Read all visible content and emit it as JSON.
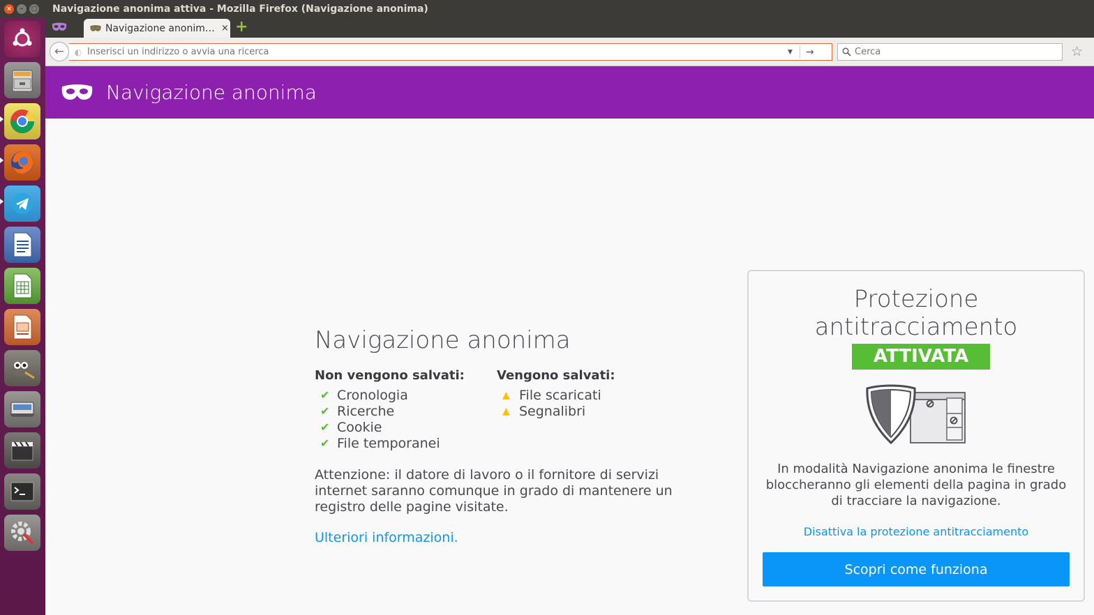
{
  "window": {
    "title": "Navigazione anonima attiva - Mozilla Firefox (Navigazione anonima)",
    "buttons": {
      "close": "×",
      "minimize": "–",
      "maximize": "□"
    }
  },
  "launcher": {
    "items": [
      {
        "name": "ubuntu-dash",
        "icon": "ubuntu-logo-icon"
      },
      {
        "name": "files",
        "icon": "file-cabinet-icon"
      },
      {
        "name": "chrome",
        "icon": "chrome-icon"
      },
      {
        "name": "firefox",
        "icon": "firefox-icon"
      },
      {
        "name": "telegram",
        "icon": "telegram-icon"
      },
      {
        "name": "writer",
        "icon": "libreoffice-writer-icon"
      },
      {
        "name": "calc",
        "icon": "libreoffice-calc-icon"
      },
      {
        "name": "impress",
        "icon": "libreoffice-impress-icon"
      },
      {
        "name": "gimp",
        "icon": "gimp-icon"
      },
      {
        "name": "scanner",
        "icon": "scanner-icon"
      },
      {
        "name": "video-editor",
        "icon": "clapperboard-icon"
      },
      {
        "name": "terminal",
        "icon": "terminal-icon"
      },
      {
        "name": "system-settings",
        "icon": "settings-icon"
      }
    ]
  },
  "tabs": {
    "active_label": "Navigazione anonim…",
    "close": "×",
    "new_tab": "+"
  },
  "navbar": {
    "back": "←",
    "url_placeholder": "Inserisci un indirizzo o avvia una ricerca",
    "url_drop": "▼",
    "url_go": "→",
    "search_placeholder": "Cerca",
    "star": "☆"
  },
  "header": {
    "title": "Navigazione anonima"
  },
  "main": {
    "title": "Navigazione anonima",
    "not_saved": {
      "title": "Non vengono salvati:",
      "items": [
        "Cronologia",
        "Ricerche",
        "Cookie",
        "File temporanei"
      ],
      "mark": "✔"
    },
    "saved": {
      "title": "Vengono salvati:",
      "items": [
        "File scaricati",
        "Segnalibri"
      ],
      "mark": "▲"
    },
    "warning": "Attenzione: il datore di lavoro o il fornitore di servizi internet saranno comunque in grado di mantenere un registro delle pagine visitate.",
    "more_link": "Ulteriori informazioni."
  },
  "tracking": {
    "title": "Protezione antitracciamento",
    "status": "ATTIVATA",
    "description": "In modalità Navigazione anonima le finestre bloccheranno gli elementi della pagina in grado di tracciare la navigazione.",
    "disable_link": "Disattiva la protezione antitracciamento",
    "button": "Scopri come funziona"
  },
  "colors": {
    "private_purple": "#8d20ae",
    "accent_blue": "#0996f8",
    "success_green": "#57bd35",
    "warning_yellow": "#ffbf00"
  }
}
